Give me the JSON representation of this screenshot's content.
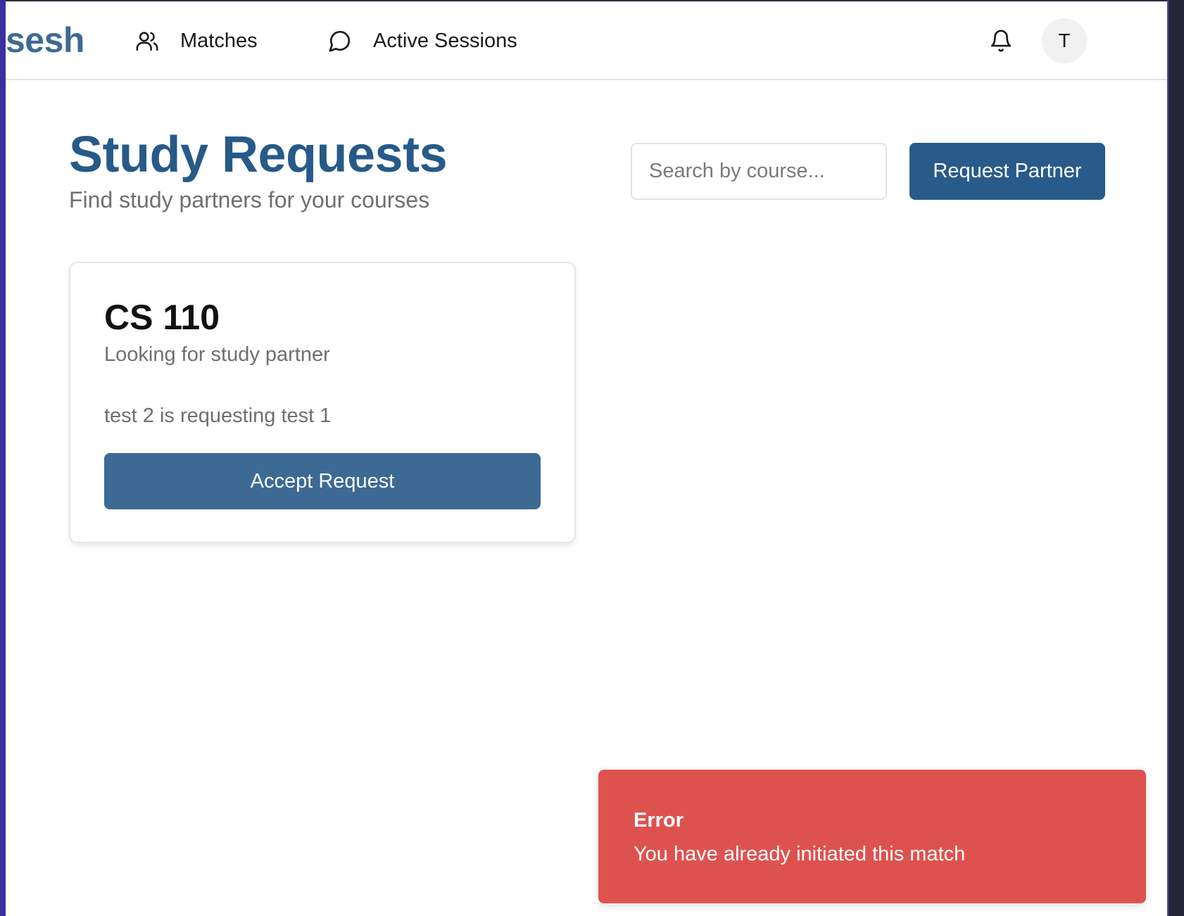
{
  "nav": {
    "logo": "sesh",
    "links": [
      {
        "label": "Matches",
        "icon": "users-icon"
      },
      {
        "label": "Active Sessions",
        "icon": "chat-bubble-icon"
      }
    ],
    "notifications_icon": "bell-icon",
    "avatar_initial": "T"
  },
  "header": {
    "title": "Study Requests",
    "subtitle": "Find study partners for your courses",
    "search_placeholder": "Search by course...",
    "search_value": "",
    "request_button": "Request Partner"
  },
  "requests": [
    {
      "course": "CS 110",
      "description": "Looking for study partner",
      "requester_text": "test 2 is requesting test 1",
      "action_label": "Accept Request"
    }
  ],
  "toast": {
    "title": "Error",
    "message": "You have already initiated this match"
  },
  "colors": {
    "brand": "#285b8a",
    "accent_button": "#3d6a95",
    "error": "#dd524f"
  }
}
